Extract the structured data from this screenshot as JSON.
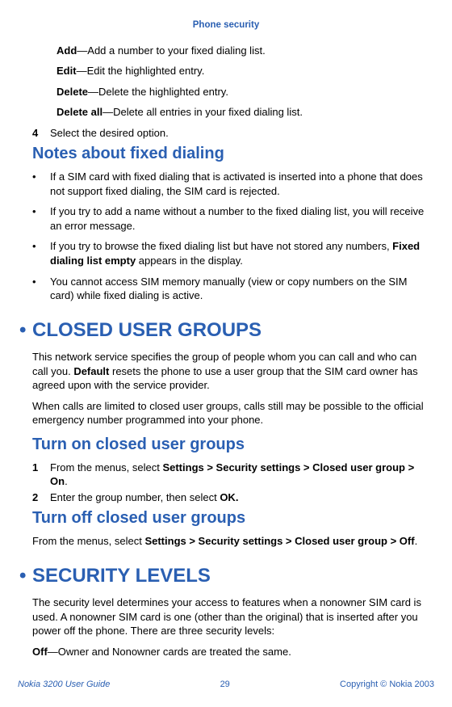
{
  "header": {
    "title": "Phone security"
  },
  "fixed_dialing": {
    "defs": [
      {
        "term": "Add",
        "desc": "—Add a number to your fixed dialing list."
      },
      {
        "term": "Edit",
        "desc": "—Edit the highlighted entry."
      },
      {
        "term": "Delete",
        "desc": "—Delete the highlighted entry."
      },
      {
        "term": "Delete all",
        "desc": "—Delete all entries in your fixed dialing list."
      }
    ],
    "step": {
      "num": "4",
      "text": "Select the desired option."
    },
    "notes_heading": "Notes about fixed dialing",
    "notes": [
      "If a SIM card with fixed dialing that is activated is inserted into a phone that does not support fixed dialing, the SIM card is rejected.",
      "If you try to add a name without a number to the fixed dialing list, you will receive an error message.",
      {
        "pre": "If you try to browse the fixed dialing list but have not stored any numbers, ",
        "bold": "Fixed dialing list empty",
        "post": " appears in the display."
      },
      "You cannot access SIM memory manually (view or copy numbers on the SIM card) while fixed dialing is active."
    ]
  },
  "closed_user_groups": {
    "heading": "CLOSED USER GROUPS",
    "para1": {
      "pre": "This network service specifies the group of people whom you can call and who can call you. ",
      "bold": "Default",
      "post": " resets the phone to use a user group that the SIM card owner has agreed upon with the service provider."
    },
    "para2": "When calls are limited to closed user groups, calls still may be possible to the official emergency number programmed into your phone.",
    "turn_on_heading": "Turn on closed user groups",
    "turn_on_steps": [
      {
        "num": "1",
        "pre": "From the menus, select ",
        "bold": "Settings > Security settings > Closed user group > On",
        "post": "."
      },
      {
        "num": "2",
        "pre": "Enter the group number, then select ",
        "bold": "OK.",
        "post": ""
      }
    ],
    "turn_off_heading": "Turn off closed user groups",
    "turn_off_para": {
      "pre": "From the menus, select ",
      "bold": "Settings > Security settings > Closed user group > Off",
      "post": "."
    }
  },
  "security_levels": {
    "heading": "SECURITY LEVELS",
    "para": "The security level determines your access to features when a nonowner SIM card is used. A nonowner SIM card is one (other than the original) that is inserted after you power off the phone. There are three security levels:",
    "defs": [
      {
        "term": "Off",
        "desc": "—Owner and Nonowner cards are treated the same."
      }
    ]
  },
  "footer": {
    "left": "Nokia 3200 User Guide",
    "center": "29",
    "right": "Copyright © Nokia 2003"
  }
}
